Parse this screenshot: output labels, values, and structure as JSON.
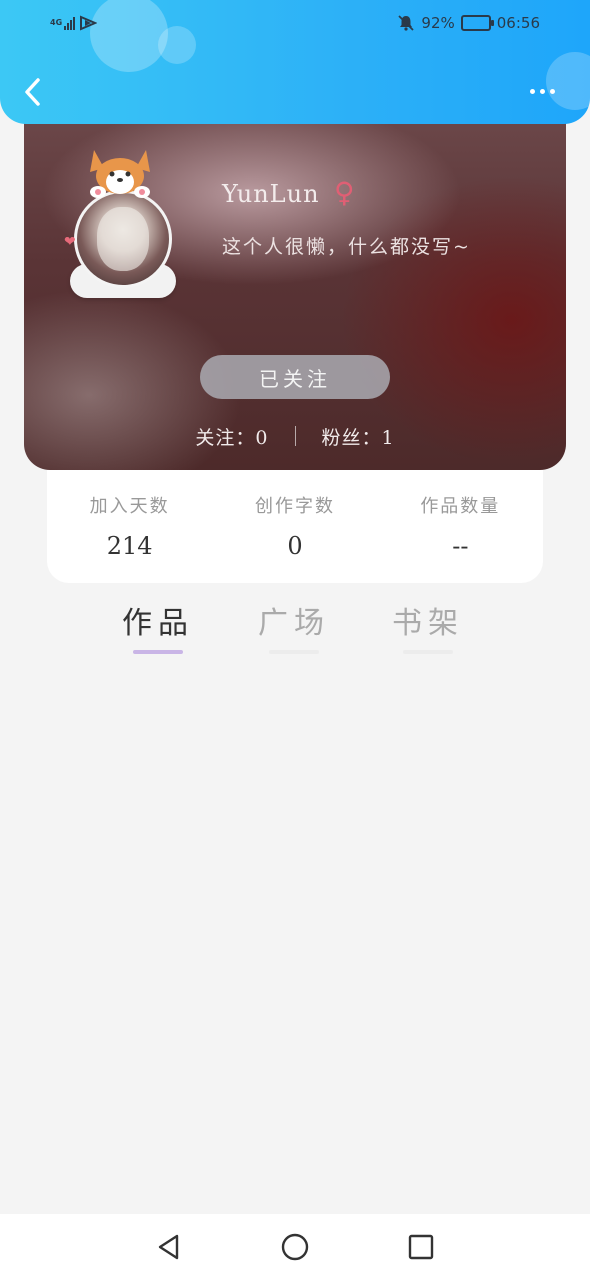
{
  "status_bar": {
    "network": "4G",
    "battery": "92%",
    "time": "06:56"
  },
  "profile": {
    "username": "YunLun",
    "gender_symbol": "♀",
    "bio": "这个人很懒，什么都没写~",
    "follow_button": "已关注",
    "following": "关注：0",
    "followers": "粉丝：1"
  },
  "stats": [
    {
      "label": "加入天数",
      "value": "214"
    },
    {
      "label": "创作字数",
      "value": "0"
    },
    {
      "label": "作品数量",
      "value": "--"
    }
  ],
  "tabs": [
    {
      "label": "作品",
      "active": true
    },
    {
      "label": "广场",
      "active": false
    },
    {
      "label": "书架",
      "active": false
    }
  ],
  "colors": {
    "header_start": "#3cc8f5",
    "header_end": "#1ea6fa",
    "tab_indicator": "#c9b5e6",
    "gender": "#e05f74"
  }
}
